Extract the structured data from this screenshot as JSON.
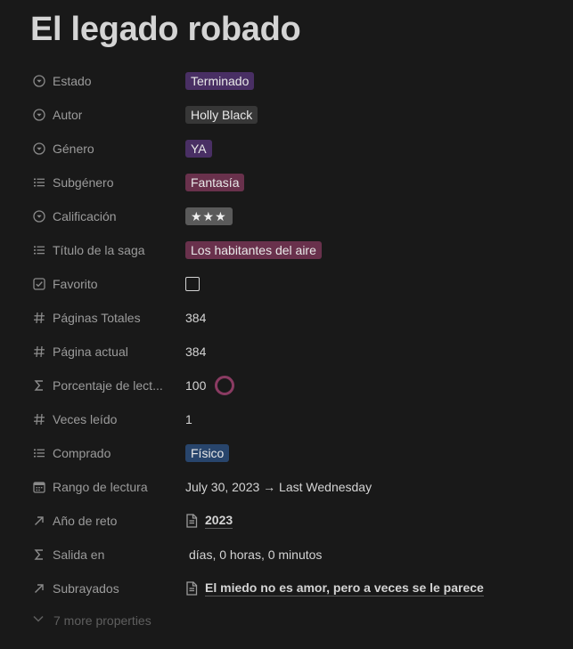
{
  "title": "El legado robado",
  "properties": [
    {
      "label": "Estado",
      "icon": "select-icon",
      "value": "Terminado",
      "type": "tag",
      "color": "#492f64"
    },
    {
      "label": "Autor",
      "icon": "select-icon",
      "value": "Holly Black",
      "type": "tag",
      "color": "#373737"
    },
    {
      "label": "Género",
      "icon": "select-icon",
      "value": "YA",
      "type": "tag",
      "color": "#492f64"
    },
    {
      "label": "Subgénero",
      "icon": "multi-select-icon",
      "value": "Fantasía",
      "type": "tag",
      "color": "#69314c"
    },
    {
      "label": "Calificación",
      "icon": "select-icon",
      "value": "★★★",
      "type": "tag",
      "color": "#5a5a5a"
    },
    {
      "label": "Título de la saga",
      "icon": "multi-select-icon",
      "value": "Los habitantes del aire",
      "type": "tag",
      "color": "#69314c"
    },
    {
      "label": "Favorito",
      "icon": "checkbox-icon",
      "value": false,
      "type": "checkbox"
    },
    {
      "label": "Páginas Totales",
      "icon": "number-icon",
      "value": "384",
      "type": "text"
    },
    {
      "label": "Página actual",
      "icon": "number-icon",
      "value": "384",
      "type": "text"
    },
    {
      "label": "Porcentaje de lect...",
      "icon": "formula-icon",
      "value": "100",
      "type": "progress",
      "progress": 1.0,
      "color": "#8a3b62"
    },
    {
      "label": "Veces leído",
      "icon": "number-icon",
      "value": "1",
      "type": "text"
    },
    {
      "label": "Comprado",
      "icon": "multi-select-icon",
      "value": "Físico",
      "type": "tag",
      "color": "#28456c"
    },
    {
      "label": "Rango de lectura",
      "icon": "calendar-icon",
      "value": "July 30, 2023 → Last Wednesday",
      "type": "text"
    },
    {
      "label": "Año de reto",
      "icon": "relation-icon",
      "value": "2023",
      "type": "link"
    },
    {
      "label": "Salida en",
      "icon": "formula-icon",
      "value": " días, 0 horas, 0 minutos",
      "type": "text"
    },
    {
      "label": "Subrayados",
      "icon": "relation-icon",
      "value": "El miedo no es amor, pero a veces se le parece",
      "type": "link"
    }
  ],
  "more_properties": "7 more properties"
}
